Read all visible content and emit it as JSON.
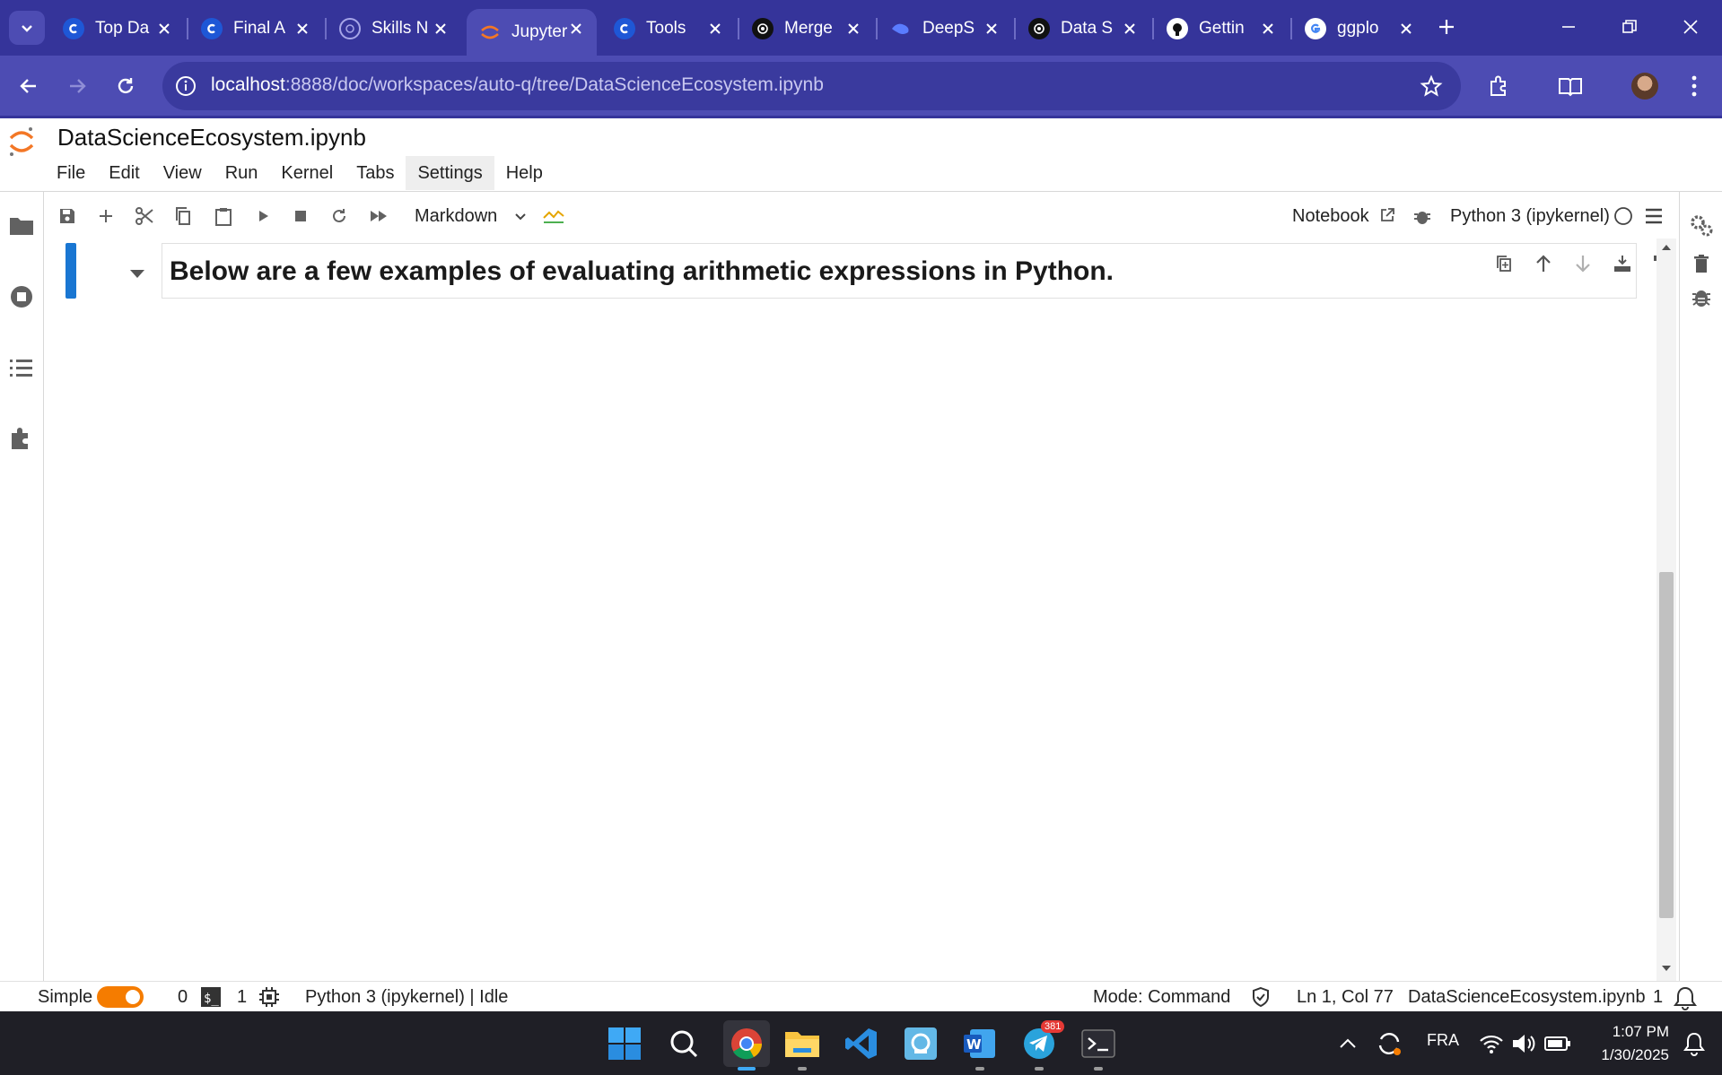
{
  "browser": {
    "tabs": [
      {
        "title": "Top Da",
        "favicon": "coursera-icon",
        "active": false
      },
      {
        "title": "Final A",
        "favicon": "coursera-icon",
        "active": false
      },
      {
        "title": "Skills N",
        "favicon": "skills-icon",
        "active": false
      },
      {
        "title": "Jupyter",
        "favicon": "jupyter-icon",
        "active": true
      },
      {
        "title": "Tools",
        "favicon": "coursera-icon",
        "active": false
      },
      {
        "title": "Merge",
        "favicon": "chatgpt-icon",
        "active": false
      },
      {
        "title": "DeepS",
        "favicon": "deepseek-icon",
        "active": false
      },
      {
        "title": "Data S",
        "favicon": "chatgpt-icon",
        "active": false
      },
      {
        "title": "Gettin",
        "favicon": "github-icon",
        "active": false
      },
      {
        "title": "ggplo",
        "favicon": "google-icon",
        "active": false
      }
    ],
    "url_host": "localhost",
    "url_path": ":8888/doc/workspaces/auto-q/tree/DataScienceEcosystem.ipynb",
    "colors": {
      "tabstrip": "#35349a",
      "navbar": "#4d4cb3"
    }
  },
  "jupyter": {
    "doc_title": "DataScienceEcosystem.ipynb",
    "menu": [
      "File",
      "Edit",
      "View",
      "Run",
      "Kernel",
      "Tabs",
      "Settings",
      "Help"
    ],
    "toolbar": {
      "cell_type": "Markdown",
      "notebook_label": "Notebook",
      "kernel_label": "Python 3 (ipykernel)"
    },
    "cell": {
      "text": "Below are a few examples of evaluating arithmetic expressions in Python."
    },
    "status": {
      "mode_label": "Simple",
      "terminals": "0",
      "kernels": "1",
      "kernel_state": "Python 3 (ipykernel) | Idle",
      "mode": "Mode: Command",
      "cursor": "Ln 1, Col 77",
      "filename": "DataScienceEcosystem.ipynb",
      "notifications": "1"
    },
    "colors": {
      "accent": "#f57c00",
      "active_cell": "#1976d2"
    }
  },
  "taskbar": {
    "telegram_badge": "381",
    "language": "FRA",
    "time": "1:07 PM",
    "date": "1/30/2025"
  }
}
